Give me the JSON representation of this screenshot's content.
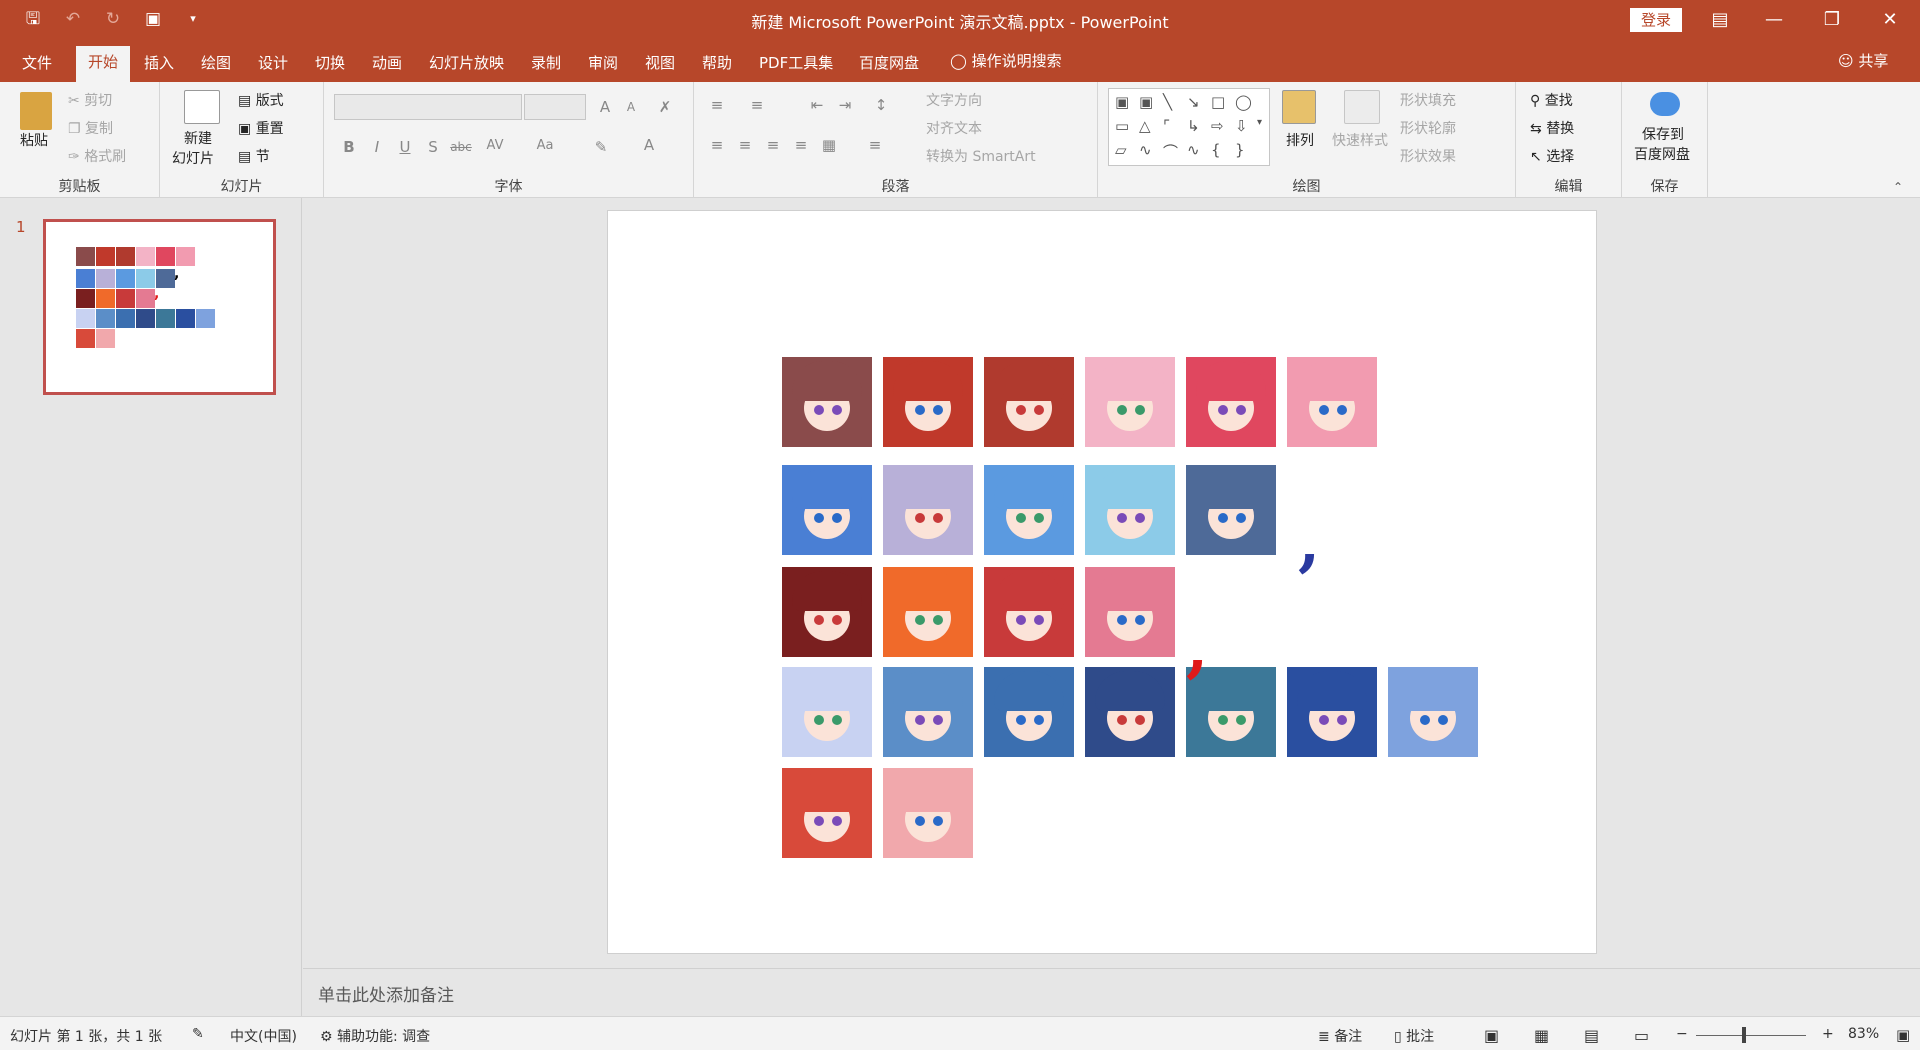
{
  "window": {
    "title": "新建 Microsoft PowerPoint 演示文稿.pptx  -  PowerPoint",
    "login_label": "登录",
    "qat_icons": [
      "save-icon",
      "undo-icon",
      "redo-icon",
      "presenter-icon",
      "customize-icon"
    ],
    "controls": [
      "ribbon-display-icon",
      "minimize-icon",
      "restore-icon",
      "close-icon"
    ]
  },
  "tabs": {
    "file": "文件",
    "home": "开始",
    "insert": "插入",
    "draw": "绘图",
    "design": "设计",
    "transitions": "切换",
    "animations": "动画",
    "slideshow": "幻灯片放映",
    "record": "录制",
    "review": "审阅",
    "view": "视图",
    "help": "帮助",
    "pdf": "PDF工具集",
    "baidu": "百度网盘",
    "tell_me": "操作说明搜索",
    "share": "共享"
  },
  "ribbon": {
    "clipboard": {
      "label": "剪贴板",
      "paste": "粘贴",
      "cut": "剪切",
      "copy": "复制",
      "format_painter": "格式刷"
    },
    "slides": {
      "label": "幻灯片",
      "new_slide_1": "新建",
      "new_slide_2": "幻灯片",
      "layout": "版式",
      "reset": "重置",
      "section": "节"
    },
    "font": {
      "label": "字体",
      "bold": "B",
      "italic": "I",
      "underline": "U",
      "shadow": "S",
      "strike": "abc",
      "spacing": "AV",
      "case": "Aa",
      "grow": "A",
      "shrink": "A",
      "color": "A"
    },
    "paragraph": {
      "label": "段落",
      "text_direction": "文字方向",
      "align_text": "对齐文本",
      "smartart": "转换为 SmartArt"
    },
    "drawing": {
      "label": "绘图",
      "arrange": "排列",
      "quick_styles": "快速样式",
      "shape_fill": "形状填充",
      "shape_outline": "形状轮廓",
      "shape_effects": "形状效果"
    },
    "editing": {
      "label": "编辑",
      "find": "查找",
      "replace": "替换",
      "select": "选择"
    },
    "save": {
      "label": "保存",
      "save_to_1": "保存到",
      "save_to_2": "百度网盘"
    }
  },
  "thumbnails": {
    "slide_number": "1"
  },
  "slide": {
    "rows": [
      [
        "#8a4b4b",
        "#c0392b",
        "#b03a2e",
        "#f3b3c6",
        "#e0475f",
        "#f29bb0"
      ],
      [
        "#4a7fd4",
        "#b8b0d8",
        "#5b9ae0",
        "#8ccbe8",
        "#4e6a98"
      ],
      [
        "#7a1f1f",
        "#f06a2a",
        "#c83a3a",
        "#e47a92"
      ],
      [
        "#c8d2f2",
        "#5b8ec8",
        "#3b6fb0",
        "#2f4b8a",
        "#3c7898",
        "#2a4fa0",
        "#7ea2de"
      ],
      [
        "#d84a3a",
        "#f1a8ac"
      ]
    ],
    "commas": [
      {
        "char": ",",
        "color": "#2a3aa0"
      },
      {
        "char": ",",
        "color": "#e01a1a"
      }
    ]
  },
  "notes_placeholder": "单击此处添加备注",
  "status": {
    "slide_info": "幻灯片 第 1 张，共 1 张",
    "language": "中文(中国)",
    "accessibility": "辅助功能: 调查",
    "notes": "备注",
    "comments": "批注",
    "zoom_minus": "−",
    "zoom_plus": "+",
    "zoom": "83%"
  },
  "colors": {
    "accent": "#b7472a",
    "thumb_border": "#c0504d"
  }
}
